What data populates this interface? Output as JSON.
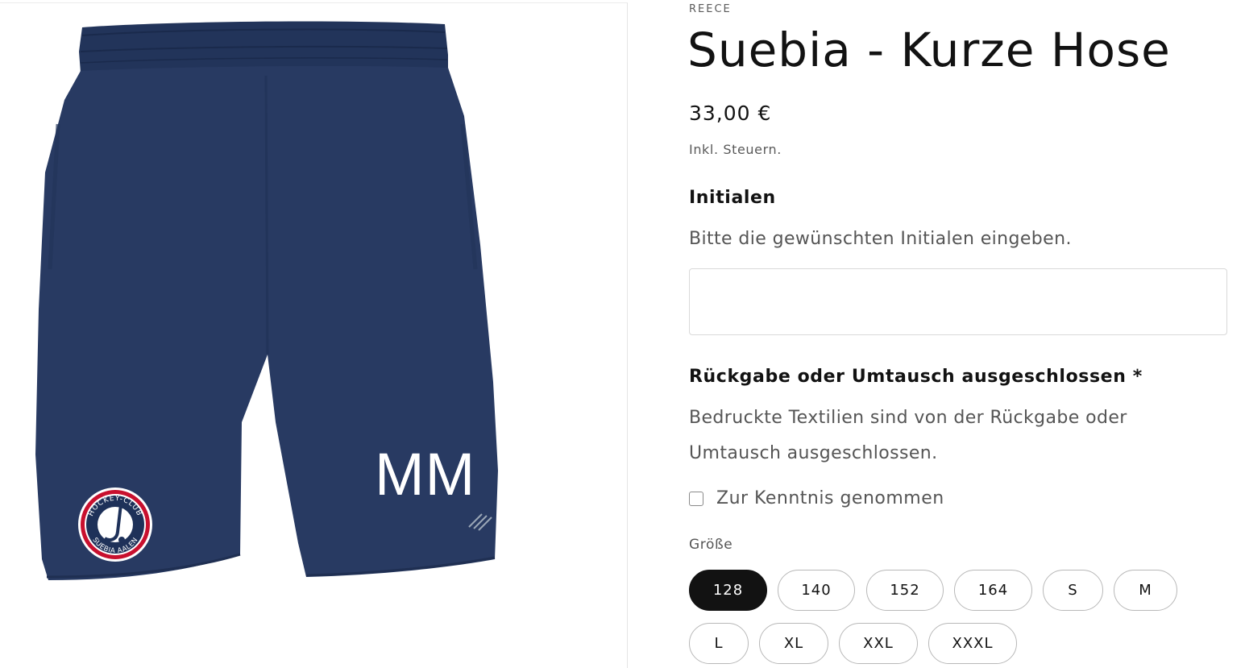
{
  "media": {
    "print_initials": "MM",
    "badge_text_top": "HOCKEY-CLUB",
    "badge_text_bottom": "SUEBIA AALEN",
    "colors": {
      "shorts": "#283a62",
      "badge_ring": "#c8102e",
      "badge_center": "#1e3159"
    }
  },
  "product": {
    "vendor": "REECE",
    "title": "Suebia - Kurze Hose",
    "price": "33,00 €",
    "tax_note": "Inkl. Steuern."
  },
  "initials": {
    "label": "Initialen",
    "help_text": "Bitte die gewünschten Initialen eingeben.",
    "value": "",
    "placeholder": ""
  },
  "return_policy": {
    "label": "Rückgabe oder Umtausch ausgeschlossen *",
    "text": "Bedruckte Textilien sind von der Rückgabe oder Umtausch ausgeschlossen.",
    "checkbox_label": "Zur Kenntnis genommen",
    "checked": false
  },
  "size": {
    "label": "Größe",
    "selected": "128",
    "options": [
      "128",
      "140",
      "152",
      "164",
      "S",
      "M",
      "L",
      "XL",
      "XXL",
      "XXXL"
    ]
  },
  "colors": {
    "text": "#121212",
    "muted_text": "#555555",
    "selected_pill_bg": "#121212",
    "selected_pill_text": "#ffffff"
  }
}
